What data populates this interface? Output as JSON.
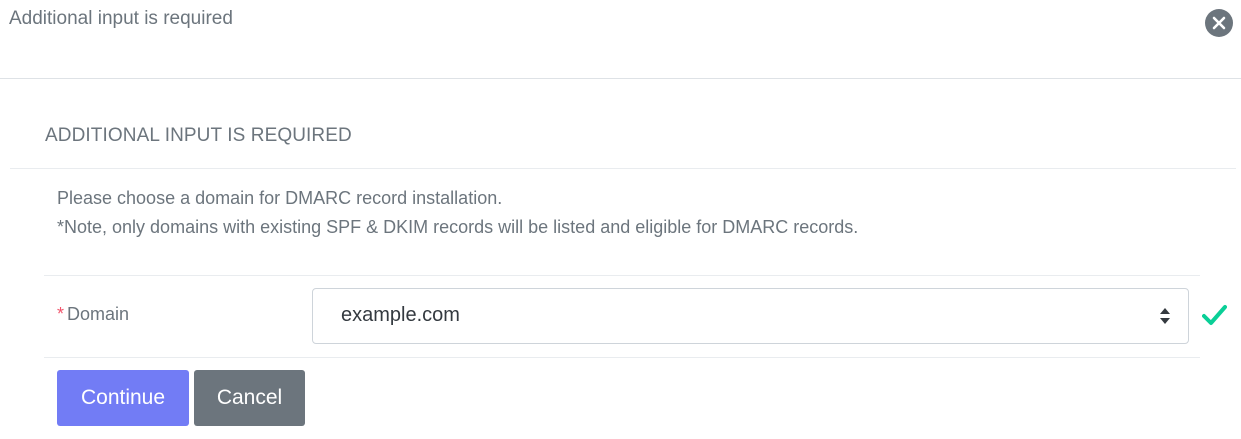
{
  "header": {
    "title": "Additional input is required"
  },
  "section": {
    "title": "ADDITIONAL INPUT IS REQUIRED",
    "description_line1": "Please choose a domain for DMARC record installation.",
    "description_line2": "*Note, only domains with existing SPF & DKIM records will be listed and eligible for DMARC records."
  },
  "form": {
    "required_marker": "*",
    "domain_label": "Domain",
    "domain_value": "example.com"
  },
  "buttons": {
    "continue_label": "Continue",
    "cancel_label": "Cancel"
  },
  "colors": {
    "primary": "#727cf5",
    "secondary": "#6c757d",
    "required": "#f1556c",
    "valid": "#0acf97"
  },
  "icons": {
    "close": "close-circle-icon",
    "select_arrows": "sort-arrows-icon",
    "valid": "checkmark-icon"
  }
}
